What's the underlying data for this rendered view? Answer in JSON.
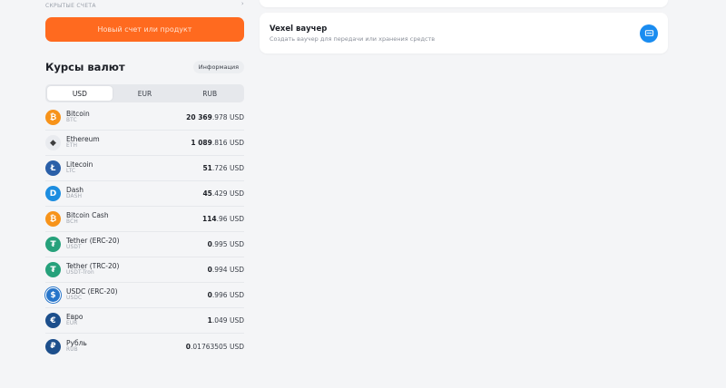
{
  "accounts": {
    "hidden_label": "СКРЫТЫЕ СЧЕТА",
    "chevron": "›"
  },
  "new_button_label": "Новый счет или продукт",
  "rates": {
    "title": "Курсы валют",
    "info_label": "Информация",
    "tabs": [
      {
        "label": "USD",
        "active": true
      },
      {
        "label": "EUR",
        "active": false
      },
      {
        "label": "RUB",
        "active": false
      }
    ],
    "currency_suffix": "USD",
    "items": [
      {
        "name": "Bitcoin",
        "ticker": "BTC",
        "price_main": "20 369",
        "price_frac": ".978",
        "icon": "bitcoin-icon",
        "color": "#f7931a",
        "glyph": "₿"
      },
      {
        "name": "Ethereum",
        "ticker": "ETH",
        "price_main": "1 089",
        "price_frac": ".816",
        "icon": "ethereum-icon",
        "color": "#e9ebef",
        "glyph": "◆"
      },
      {
        "name": "Litecoin",
        "ticker": "LTC",
        "price_main": "51",
        "price_frac": ".726",
        "icon": "litecoin-icon",
        "color": "#2a5fa8",
        "glyph": "Ł"
      },
      {
        "name": "Dash",
        "ticker": "DASH",
        "price_main": "45",
        "price_frac": ".429",
        "icon": "dash-icon",
        "color": "#1c8de0",
        "glyph": "D"
      },
      {
        "name": "Bitcoin Cash",
        "ticker": "BCH",
        "price_main": "114",
        "price_frac": ".96",
        "icon": "bitcoin-cash-icon",
        "color": "#f7931a",
        "glyph": "₿"
      },
      {
        "name": "Tether (ERC-20)",
        "ticker": "USDT",
        "price_main": "0",
        "price_frac": ".995",
        "icon": "tether-icon",
        "color": "#26a17b",
        "glyph": "₮"
      },
      {
        "name": "Tether (TRC-20)",
        "ticker": "USDT-Tron",
        "price_main": "0",
        "price_frac": ".994",
        "icon": "tether-icon",
        "color": "#26a17b",
        "glyph": "₮"
      },
      {
        "name": "USDC (ERC-20)",
        "ticker": "USDC",
        "price_main": "0",
        "price_frac": ".996",
        "icon": "usdc-icon",
        "color": "#2775ca",
        "glyph": "$"
      },
      {
        "name": "Евро",
        "ticker": "EUR",
        "price_main": "1",
        "price_frac": ".049",
        "icon": "euro-icon",
        "color": "#1d4f8c",
        "glyph": "€"
      },
      {
        "name": "Рубль",
        "ticker": "RUB",
        "price_main": "0",
        "price_frac": ".01763505",
        "icon": "ruble-icon",
        "color": "#1d4f8c",
        "glyph": "₽"
      }
    ]
  },
  "voucher": {
    "title": "Vexel ваучер",
    "subtitle": "Создать ваучер для передачи или хранения средств",
    "icon": "voucher-card-icon",
    "icon_color": "#1a8cf0"
  },
  "colors": {
    "accent": "#ff6a1f",
    "background": "#f4f5f7"
  }
}
